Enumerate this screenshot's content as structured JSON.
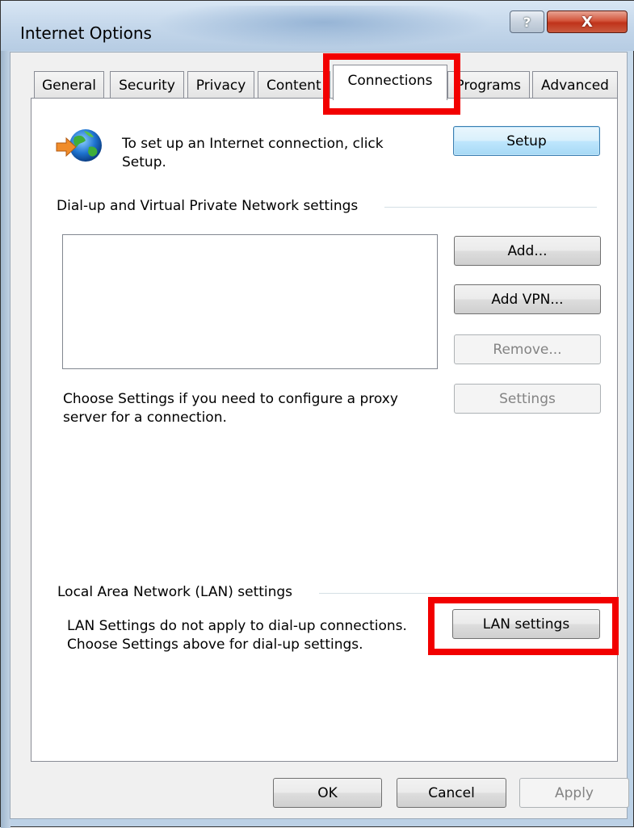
{
  "window": {
    "title": "Internet Options",
    "help_glyph": "?",
    "close_glyph": "X"
  },
  "tabs": [
    {
      "label": "General"
    },
    {
      "label": "Security"
    },
    {
      "label": "Privacy"
    },
    {
      "label": "Content"
    },
    {
      "label": "Connections",
      "selected": true
    },
    {
      "label": "Programs"
    },
    {
      "label": "Advanced"
    }
  ],
  "connections": {
    "setup_text": "To set up an Internet connection, click Setup.",
    "setup_text_line1": "To set up an Internet connection, click",
    "setup_text_line2": "Setup.",
    "setup_button": "Setup",
    "dialup_section_label": "Dial-up and Virtual Private Network settings",
    "add_button": "Add...",
    "add_vpn_button": "Add VPN...",
    "remove_button": "Remove...",
    "settings_text_line1": "Choose Settings if you need to configure a proxy",
    "settings_text_line2": "server for a connection.",
    "settings_button": "Settings",
    "lan_section_label": "Local Area Network (LAN) settings",
    "lan_text_line1": "LAN Settings do not apply to dial-up connections.",
    "lan_text_line2": "Choose Settings above for dial-up settings.",
    "lan_button": "LAN settings"
  },
  "footer": {
    "ok_button": "OK",
    "cancel_button": "Cancel",
    "apply_button": "Apply"
  },
  "icons": {
    "globe": "network-globe-icon",
    "help": "help-icon",
    "close": "close-icon"
  },
  "colors": {
    "highlight": "#f20000",
    "default_button_border": "#3c7fb1",
    "disabled_text": "#838383"
  }
}
